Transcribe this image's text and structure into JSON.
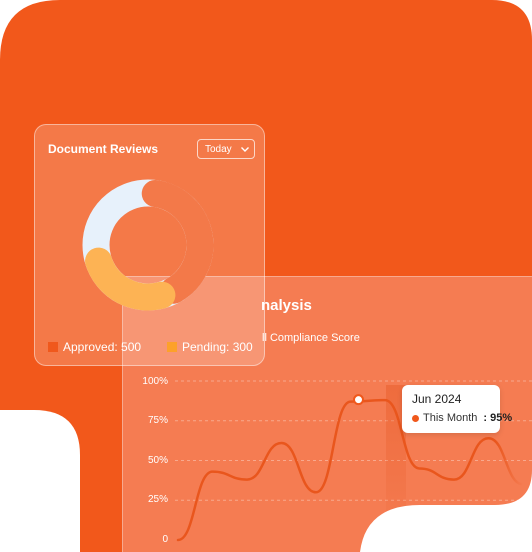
{
  "colors": {
    "brand_orange": "#F2581B",
    "approved": "#F0581C",
    "pending": "#FDA12A",
    "donut_track": "#E2EEFB"
  },
  "document_reviews": {
    "title": "Document Reviews",
    "period_selector": {
      "value": "Today",
      "icon": "chevron-down-icon"
    },
    "legend": [
      {
        "label": "Approved: 500",
        "color": "#F0581C"
      },
      {
        "label": "Pending: 300",
        "color": "#FDA12A"
      }
    ]
  },
  "analysis": {
    "title_partial": "nalysis",
    "subtitle_partial": "ll Compliance Score"
  },
  "chart_data": [
    {
      "type": "pie",
      "values": [
        500,
        300
      ],
      "labels": [
        "Approved: 500",
        "Pending: 300"
      ],
      "colors": [
        "#F0581C",
        "#FDA12A"
      ]
    },
    {
      "type": "line",
      "y_ticks": [
        "100%",
        "75%",
        "50%",
        "25%",
        "0"
      ],
      "ylim": [
        0,
        100
      ],
      "series": [
        {
          "values": [
            0,
            43,
            38,
            61,
            30,
            87,
            88,
            45,
            38,
            64,
            35
          ]
        }
      ]
    }
  ],
  "tooltip": {
    "date": "Jun 2024",
    "series_label": "This Month",
    "value": ": 95%"
  }
}
